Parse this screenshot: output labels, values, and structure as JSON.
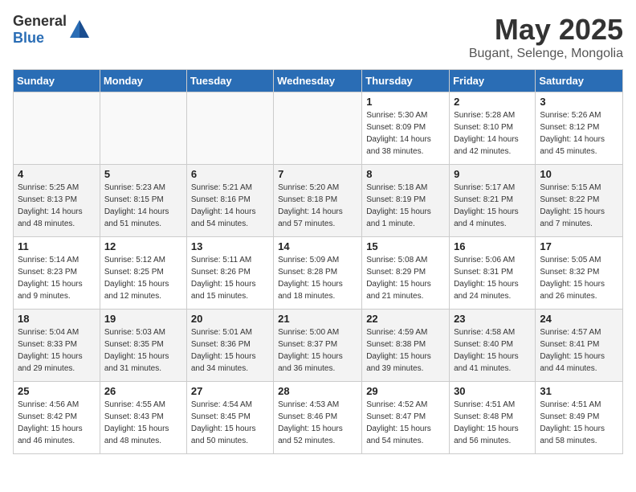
{
  "header": {
    "logo_general": "General",
    "logo_blue": "Blue",
    "month_year": "May 2025",
    "location": "Bugant, Selenge, Mongolia"
  },
  "weekdays": [
    "Sunday",
    "Monday",
    "Tuesday",
    "Wednesday",
    "Thursday",
    "Friday",
    "Saturday"
  ],
  "weeks": [
    [
      {
        "day": "",
        "info": ""
      },
      {
        "day": "",
        "info": ""
      },
      {
        "day": "",
        "info": ""
      },
      {
        "day": "",
        "info": ""
      },
      {
        "day": "1",
        "info": "Sunrise: 5:30 AM\nSunset: 8:09 PM\nDaylight: 14 hours\nand 38 minutes."
      },
      {
        "day": "2",
        "info": "Sunrise: 5:28 AM\nSunset: 8:10 PM\nDaylight: 14 hours\nand 42 minutes."
      },
      {
        "day": "3",
        "info": "Sunrise: 5:26 AM\nSunset: 8:12 PM\nDaylight: 14 hours\nand 45 minutes."
      }
    ],
    [
      {
        "day": "4",
        "info": "Sunrise: 5:25 AM\nSunset: 8:13 PM\nDaylight: 14 hours\nand 48 minutes."
      },
      {
        "day": "5",
        "info": "Sunrise: 5:23 AM\nSunset: 8:15 PM\nDaylight: 14 hours\nand 51 minutes."
      },
      {
        "day": "6",
        "info": "Sunrise: 5:21 AM\nSunset: 8:16 PM\nDaylight: 14 hours\nand 54 minutes."
      },
      {
        "day": "7",
        "info": "Sunrise: 5:20 AM\nSunset: 8:18 PM\nDaylight: 14 hours\nand 57 minutes."
      },
      {
        "day": "8",
        "info": "Sunrise: 5:18 AM\nSunset: 8:19 PM\nDaylight: 15 hours\nand 1 minute."
      },
      {
        "day": "9",
        "info": "Sunrise: 5:17 AM\nSunset: 8:21 PM\nDaylight: 15 hours\nand 4 minutes."
      },
      {
        "day": "10",
        "info": "Sunrise: 5:15 AM\nSunset: 8:22 PM\nDaylight: 15 hours\nand 7 minutes."
      }
    ],
    [
      {
        "day": "11",
        "info": "Sunrise: 5:14 AM\nSunset: 8:23 PM\nDaylight: 15 hours\nand 9 minutes."
      },
      {
        "day": "12",
        "info": "Sunrise: 5:12 AM\nSunset: 8:25 PM\nDaylight: 15 hours\nand 12 minutes."
      },
      {
        "day": "13",
        "info": "Sunrise: 5:11 AM\nSunset: 8:26 PM\nDaylight: 15 hours\nand 15 minutes."
      },
      {
        "day": "14",
        "info": "Sunrise: 5:09 AM\nSunset: 8:28 PM\nDaylight: 15 hours\nand 18 minutes."
      },
      {
        "day": "15",
        "info": "Sunrise: 5:08 AM\nSunset: 8:29 PM\nDaylight: 15 hours\nand 21 minutes."
      },
      {
        "day": "16",
        "info": "Sunrise: 5:06 AM\nSunset: 8:31 PM\nDaylight: 15 hours\nand 24 minutes."
      },
      {
        "day": "17",
        "info": "Sunrise: 5:05 AM\nSunset: 8:32 PM\nDaylight: 15 hours\nand 26 minutes."
      }
    ],
    [
      {
        "day": "18",
        "info": "Sunrise: 5:04 AM\nSunset: 8:33 PM\nDaylight: 15 hours\nand 29 minutes."
      },
      {
        "day": "19",
        "info": "Sunrise: 5:03 AM\nSunset: 8:35 PM\nDaylight: 15 hours\nand 31 minutes."
      },
      {
        "day": "20",
        "info": "Sunrise: 5:01 AM\nSunset: 8:36 PM\nDaylight: 15 hours\nand 34 minutes."
      },
      {
        "day": "21",
        "info": "Sunrise: 5:00 AM\nSunset: 8:37 PM\nDaylight: 15 hours\nand 36 minutes."
      },
      {
        "day": "22",
        "info": "Sunrise: 4:59 AM\nSunset: 8:38 PM\nDaylight: 15 hours\nand 39 minutes."
      },
      {
        "day": "23",
        "info": "Sunrise: 4:58 AM\nSunset: 8:40 PM\nDaylight: 15 hours\nand 41 minutes."
      },
      {
        "day": "24",
        "info": "Sunrise: 4:57 AM\nSunset: 8:41 PM\nDaylight: 15 hours\nand 44 minutes."
      }
    ],
    [
      {
        "day": "25",
        "info": "Sunrise: 4:56 AM\nSunset: 8:42 PM\nDaylight: 15 hours\nand 46 minutes."
      },
      {
        "day": "26",
        "info": "Sunrise: 4:55 AM\nSunset: 8:43 PM\nDaylight: 15 hours\nand 48 minutes."
      },
      {
        "day": "27",
        "info": "Sunrise: 4:54 AM\nSunset: 8:45 PM\nDaylight: 15 hours\nand 50 minutes."
      },
      {
        "day": "28",
        "info": "Sunrise: 4:53 AM\nSunset: 8:46 PM\nDaylight: 15 hours\nand 52 minutes."
      },
      {
        "day": "29",
        "info": "Sunrise: 4:52 AM\nSunset: 8:47 PM\nDaylight: 15 hours\nand 54 minutes."
      },
      {
        "day": "30",
        "info": "Sunrise: 4:51 AM\nSunset: 8:48 PM\nDaylight: 15 hours\nand 56 minutes."
      },
      {
        "day": "31",
        "info": "Sunrise: 4:51 AM\nSunset: 8:49 PM\nDaylight: 15 hours\nand 58 minutes."
      }
    ]
  ]
}
